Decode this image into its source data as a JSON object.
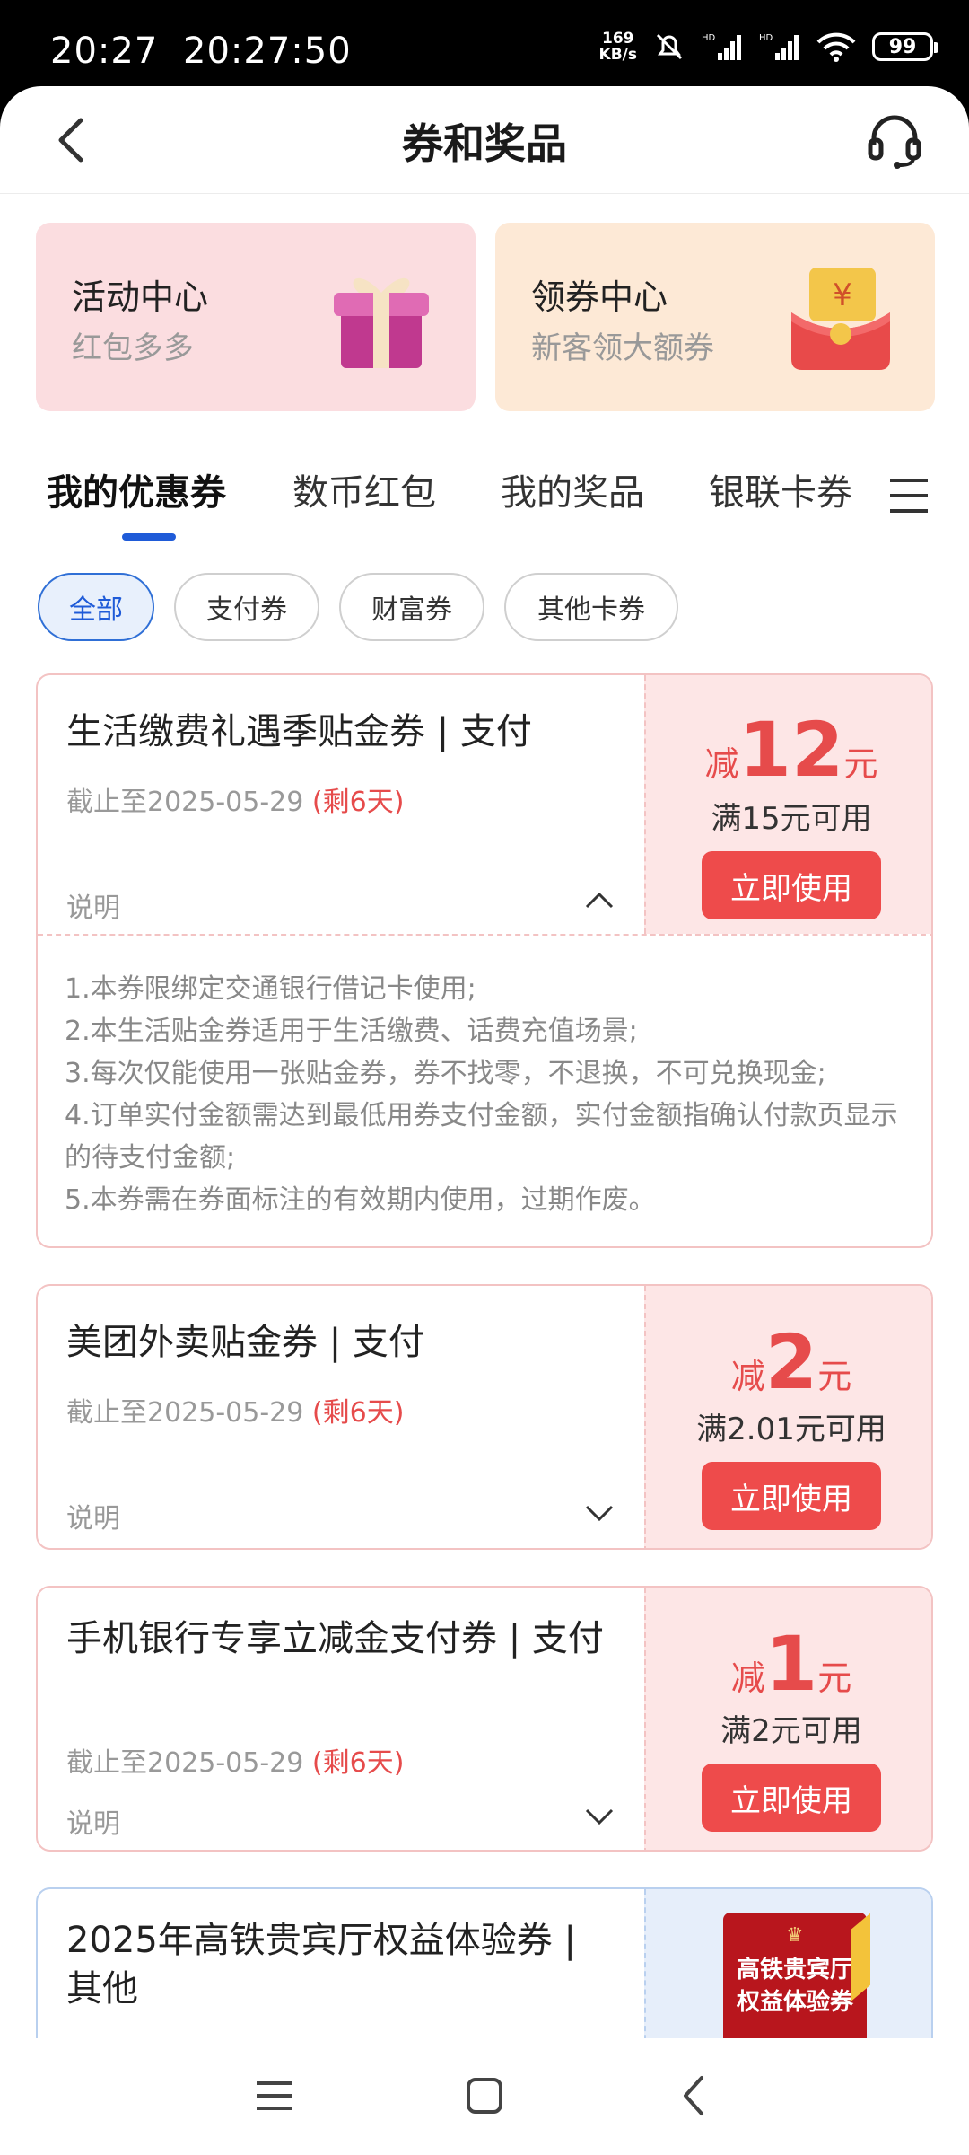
{
  "status_bar": {
    "time_left": "20:27",
    "time_clock": "20:27:50",
    "net_speed_value": "169",
    "net_speed_unit": "KB/s",
    "battery": "99"
  },
  "header": {
    "title": "券和奖品",
    "back_icon": "back-arrow-icon",
    "service_icon": "headset-icon"
  },
  "promos": [
    {
      "title": "活动中心",
      "subtitle": "红包多多",
      "icon": "gift-box-icon"
    },
    {
      "title": "领券中心",
      "subtitle": "新客领大额券",
      "icon": "red-envelope-icon"
    }
  ],
  "tabs": [
    "我的优惠券",
    "数币红包",
    "我的奖品",
    "银联卡券"
  ],
  "active_tab": 0,
  "filters": [
    "全部",
    "支付券",
    "财富券",
    "其他卡券"
  ],
  "active_filter": 0,
  "desc_label": "说明",
  "use_button_label": "立即使用",
  "coupons": [
    {
      "name": "生活缴费礼遇季贴金券 | 支付",
      "expire_prefix": "截止至2025-05-29",
      "remaining": "(剩6天)",
      "amount_prefix": "减",
      "amount": "12",
      "amount_unit": "元",
      "condition": "满15元可用",
      "expanded": true,
      "details": [
        "1.本券限绑定交通银行借记卡使用;",
        "2.本生活贴金券适用于生活缴费、话费充值场景;",
        "3.每次仅能使用一张贴金券，券不找零，不退换，不可兑换现金;",
        "4.订单实付金额需达到最低用券支付金额，实付金额指确认付款页显示的待支付金额;",
        "5.本券需在券面标注的有效期内使用，过期作废。"
      ]
    },
    {
      "name": "美团外卖贴金券 | 支付",
      "expire_prefix": "截止至2025-05-29",
      "remaining": "(剩6天)",
      "amount_prefix": "减",
      "amount": "2",
      "amount_unit": "元",
      "condition": "满2.01元可用",
      "expanded": false
    },
    {
      "name": "手机银行专享立减金支付券 | 支付",
      "expire_prefix": "截止至2025-05-29",
      "remaining": "(剩6天)",
      "amount_prefix": "减",
      "amount": "1",
      "amount_unit": "元",
      "condition": "满2元可用",
      "expanded": false
    },
    {
      "name": "2025年高铁贵宾厅权益体验券 | 其他",
      "image_line1": "高铁贵宾厅",
      "image_line2": "权益体验券"
    }
  ],
  "colors": {
    "accent_blue": "#1f5bd8",
    "coupon_red": "#ee4b4b",
    "coupon_bg_pink": "#fde6e6"
  }
}
